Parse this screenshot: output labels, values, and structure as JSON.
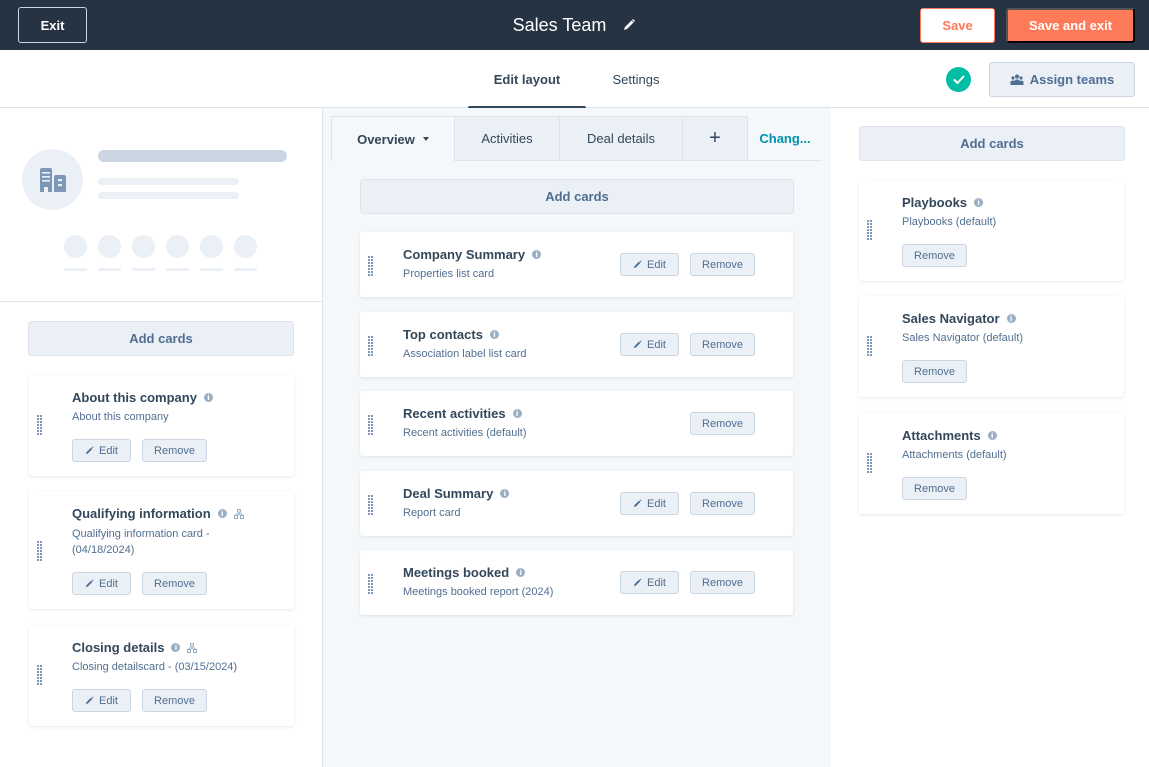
{
  "header": {
    "exit_label": "Exit",
    "title": "Sales Team",
    "save_label": "Save",
    "save_exit_label": "Save and exit"
  },
  "tabs": {
    "items": [
      {
        "label": "Edit layout",
        "active": true
      },
      {
        "label": "Settings",
        "active": false
      }
    ],
    "assign_teams_label": "Assign teams"
  },
  "left": {
    "add_cards_label": "Add cards",
    "cards": [
      {
        "title": "About this company",
        "subtitle": "About this company",
        "has_hierarchy": false,
        "edit_label": "Edit",
        "remove_label": "Remove"
      },
      {
        "title": "Qualifying information",
        "subtitle": "Qualifying information card - (04/18/2024)",
        "has_hierarchy": true,
        "edit_label": "Edit",
        "remove_label": "Remove"
      },
      {
        "title": "Closing details",
        "subtitle": "Closing detailscard - (03/15/2024)",
        "has_hierarchy": true,
        "edit_label": "Edit",
        "remove_label": "Remove"
      }
    ]
  },
  "middle": {
    "tabs": [
      {
        "label": "Overview",
        "active": true
      },
      {
        "label": "Activities",
        "active": false
      },
      {
        "label": "Deal details",
        "active": false
      },
      {
        "label": "+",
        "active": false
      },
      {
        "label": "Chang...",
        "active": false
      }
    ],
    "add_cards_label": "Add cards",
    "cards": [
      {
        "title": "Company Summary",
        "subtitle": "Properties list card",
        "edit_label": "Edit",
        "remove_label": "Remove"
      },
      {
        "title": "Top contacts",
        "subtitle": "Association label list card",
        "edit_label": "Edit",
        "remove_label": "Remove"
      },
      {
        "title": "Recent activities",
        "subtitle": "Recent activities (default)",
        "edit_label": null,
        "remove_label": "Remove"
      },
      {
        "title": "Deal Summary",
        "subtitle": "Report card",
        "edit_label": "Edit",
        "remove_label": "Remove"
      },
      {
        "title": "Meetings booked",
        "subtitle": "Meetings booked report (2024)",
        "edit_label": "Edit",
        "remove_label": "Remove"
      }
    ]
  },
  "right": {
    "add_cards_label": "Add cards",
    "cards": [
      {
        "title": "Playbooks",
        "subtitle": "Playbooks (default)",
        "remove_label": "Remove"
      },
      {
        "title": "Sales Navigator",
        "subtitle": "Sales Navigator (default)",
        "remove_label": "Remove"
      },
      {
        "title": "Attachments",
        "subtitle": "Attachments (default)",
        "remove_label": "Remove"
      }
    ]
  },
  "colors": {
    "header_bg": "#253342",
    "accent_orange": "#ff7a59",
    "success_teal": "#00bda5",
    "link_teal": "#0091ae"
  }
}
